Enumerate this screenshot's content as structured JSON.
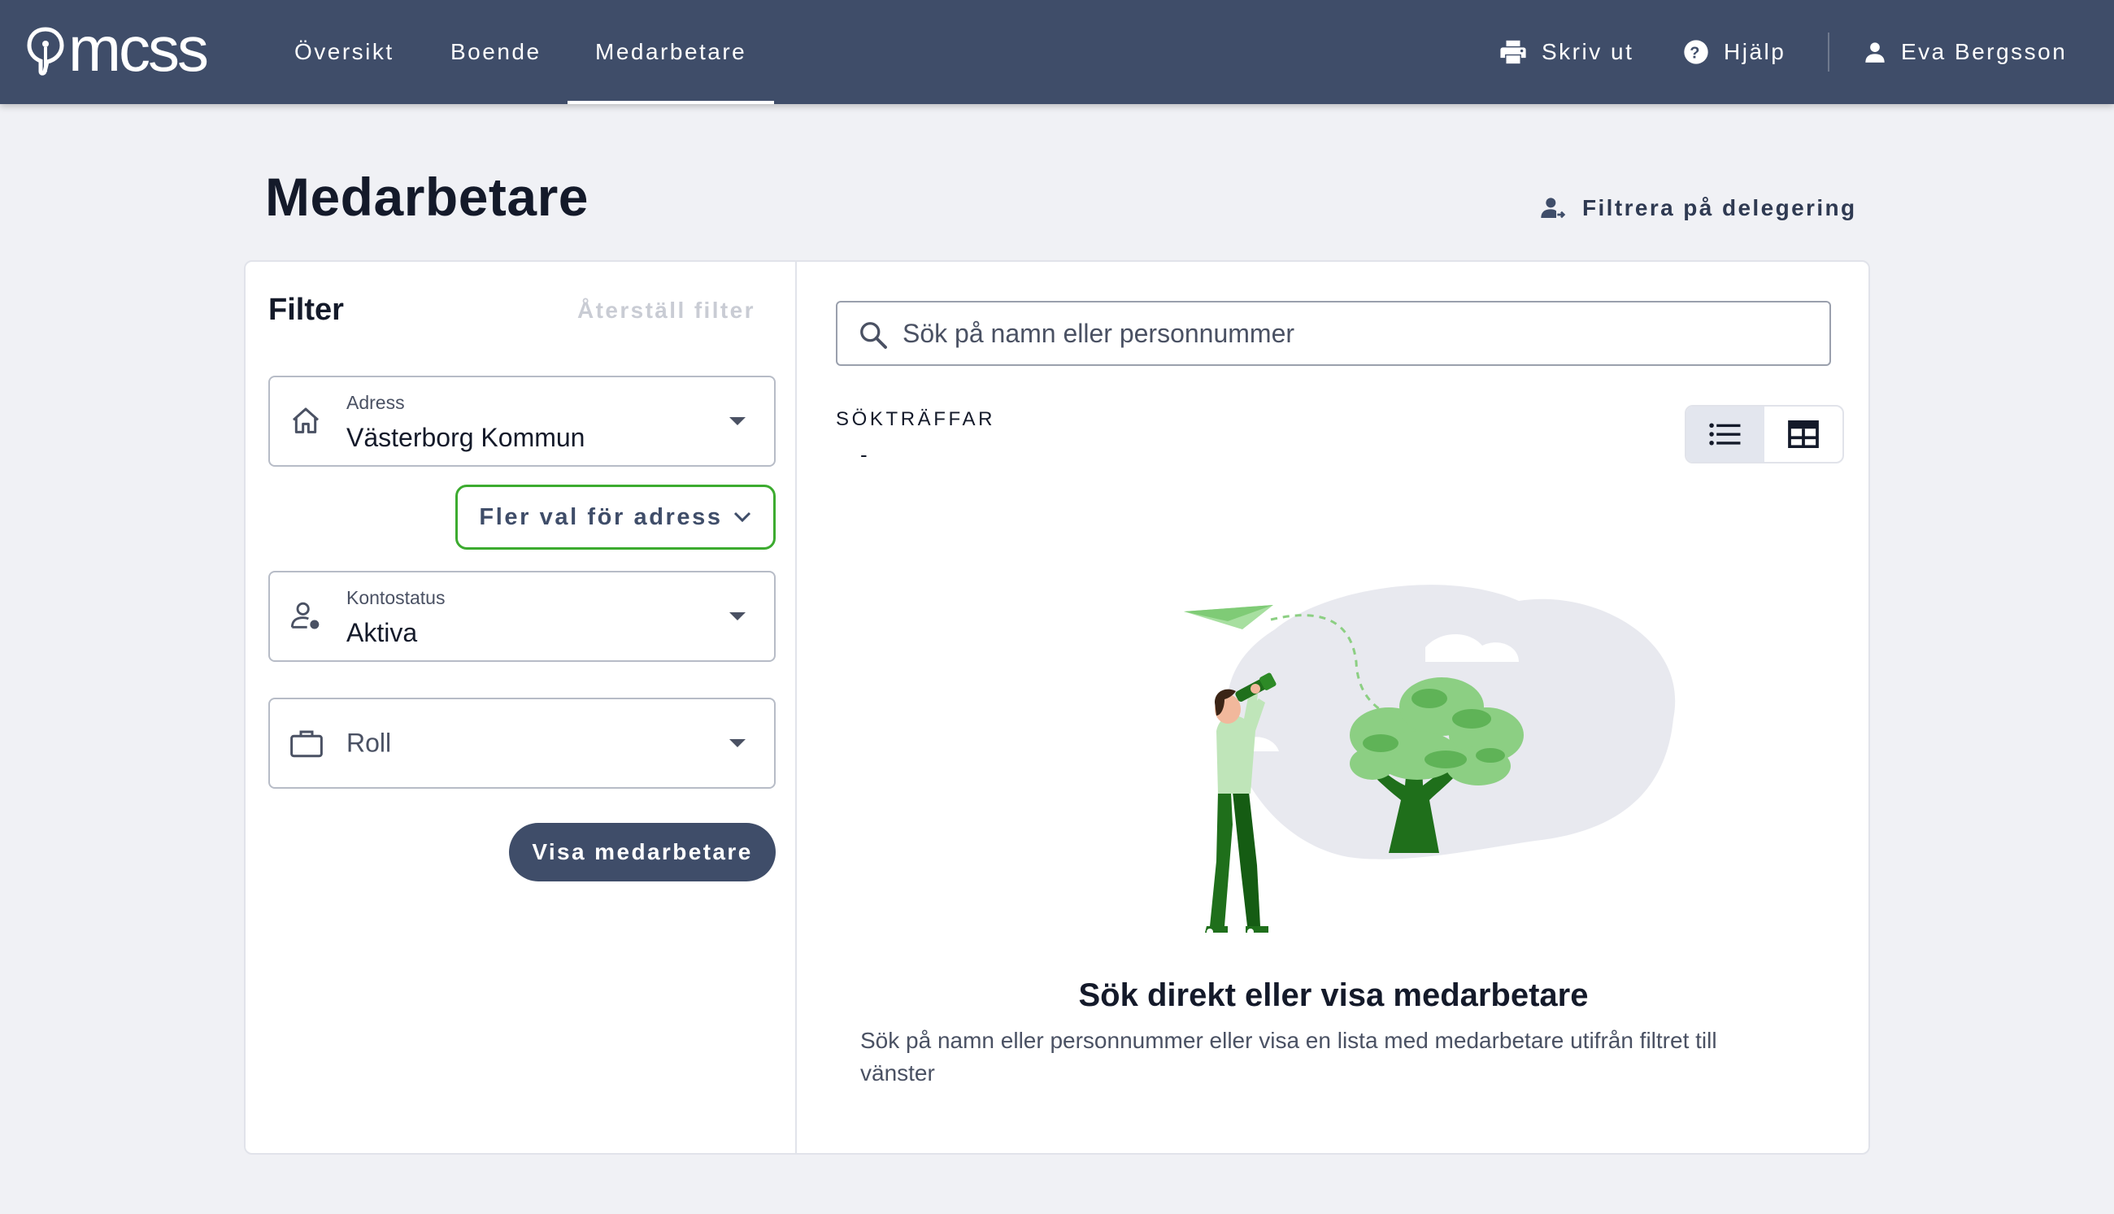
{
  "header": {
    "logo_text": "mcss",
    "nav": [
      {
        "label": "Översikt"
      },
      {
        "label": "Boende"
      },
      {
        "label": "Medarbetare",
        "active": true
      }
    ],
    "print_label": "Skriv ut",
    "help_label": "Hjälp",
    "user_name": "Eva Bergsson",
    "bar_color": "#3f4d69"
  },
  "page": {
    "title": "Medarbetare",
    "delegation_filter_label": "Filtrera på delegering"
  },
  "filter": {
    "heading": "Filter",
    "reset_label": "Återställ filter",
    "address": {
      "label": "Adress",
      "value": "Västerborg Kommun",
      "icon": "home-icon"
    },
    "more_address_label": "Fler val för adress",
    "account_status": {
      "label": "Kontostatus",
      "value": "Aktiva",
      "icon": "person-status-icon"
    },
    "role": {
      "placeholder": "Roll",
      "icon": "briefcase-icon"
    },
    "show_button_label": "Visa medarbetare"
  },
  "results": {
    "search_placeholder": "Sök på namn eller personnummer",
    "hits_label": "SÖKTRÄFFAR",
    "hits_value": "-",
    "view_mode": "list",
    "empty_title": "Sök direkt eller visa medarbetare",
    "empty_description": "Sök på namn eller personnummer eller visa en lista med medarbetare utifrån filtret till vänster"
  },
  "colors": {
    "accent_green": "#3cab2f",
    "primary": "#3f4d69",
    "background": "#f0f1f5"
  }
}
